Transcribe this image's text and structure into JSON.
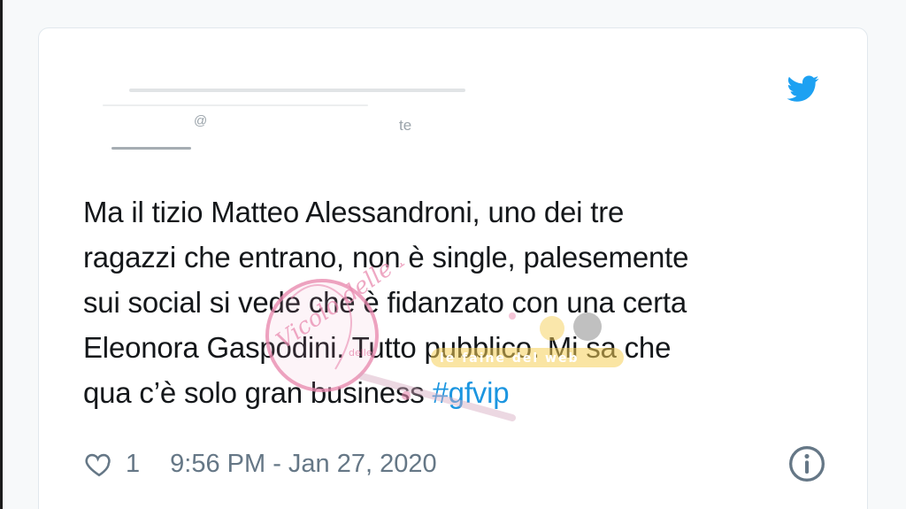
{
  "tweet": {
    "author_name": "",
    "author_handle": "@",
    "handle_fragment": "te",
    "text_lines": [
      "Ma il tizio Matteo Alessandroni, uno dei tre",
      "ragazzi che entrano, non è single, palesemente",
      "sui social si vede che è fidanzato con una certa",
      "Eleonora Gaspodini. Tutto pubblico. Mi sa che",
      "qua c’è solo gran business "
    ],
    "hashtag": "#gfvip",
    "like_count": "1",
    "timestamp": "9:56 PM - Jan 27, 2020"
  },
  "watermark": {
    "script_text": "Vicolo delle News",
    "small_text": "delle",
    "banner_text": "le faine del web"
  },
  "icons": {
    "brand": "twitter-bird-icon",
    "like": "heart-icon",
    "info": "info-icon"
  },
  "colors": {
    "brand": "#1da1f2",
    "hashtag": "#1b95e0",
    "text": "#14171a",
    "meta": "#657786",
    "watermark_pink": "#e98bb0",
    "watermark_yellow": "#f6cf57"
  }
}
